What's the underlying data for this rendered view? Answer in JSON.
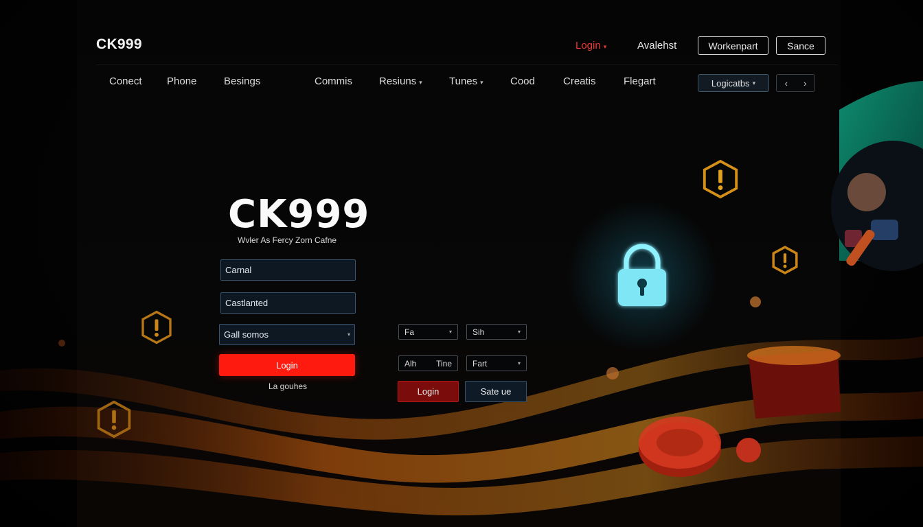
{
  "header": {
    "brand": "CK999",
    "login_link": "Login",
    "avaleriet_link": "Avalehst",
    "workenpart_button": "Workenpart",
    "sance_button": "Sance"
  },
  "nav": {
    "items": [
      "Conect",
      "Phone",
      "Besings",
      "Commis",
      "Resiuns",
      "Tunes",
      "Cood",
      "Creatis",
      "Flegart"
    ],
    "select_value": "Logicatbs",
    "pager_prev": "‹",
    "pager_next": "›"
  },
  "hero": {
    "title": "CK999",
    "subtitle": "Wvler As Fercy Zorn Cafne"
  },
  "form": {
    "field1_value": "Carnal",
    "field2_value": "Castlanted",
    "select_value": "Gall somos",
    "login_button": "Login",
    "forgot_link": "La gouhes"
  },
  "secondary_form": {
    "select_a": "Fa",
    "select_b": "Sih",
    "field_c_left": "Alh",
    "field_c_right": "Tine",
    "select_d": "Fart",
    "login_button": "Login",
    "other_button": "Sate ue"
  },
  "colors": {
    "accent_red": "#ff1a10",
    "nav_red": "#e83a32",
    "lock_cyan": "#7ff0ff",
    "hex_gold": "#e0a020"
  },
  "icons": {
    "lock": "lock-icon",
    "warning_hex": "warning-hex-icon",
    "chevron": "chevron-down-icon"
  }
}
